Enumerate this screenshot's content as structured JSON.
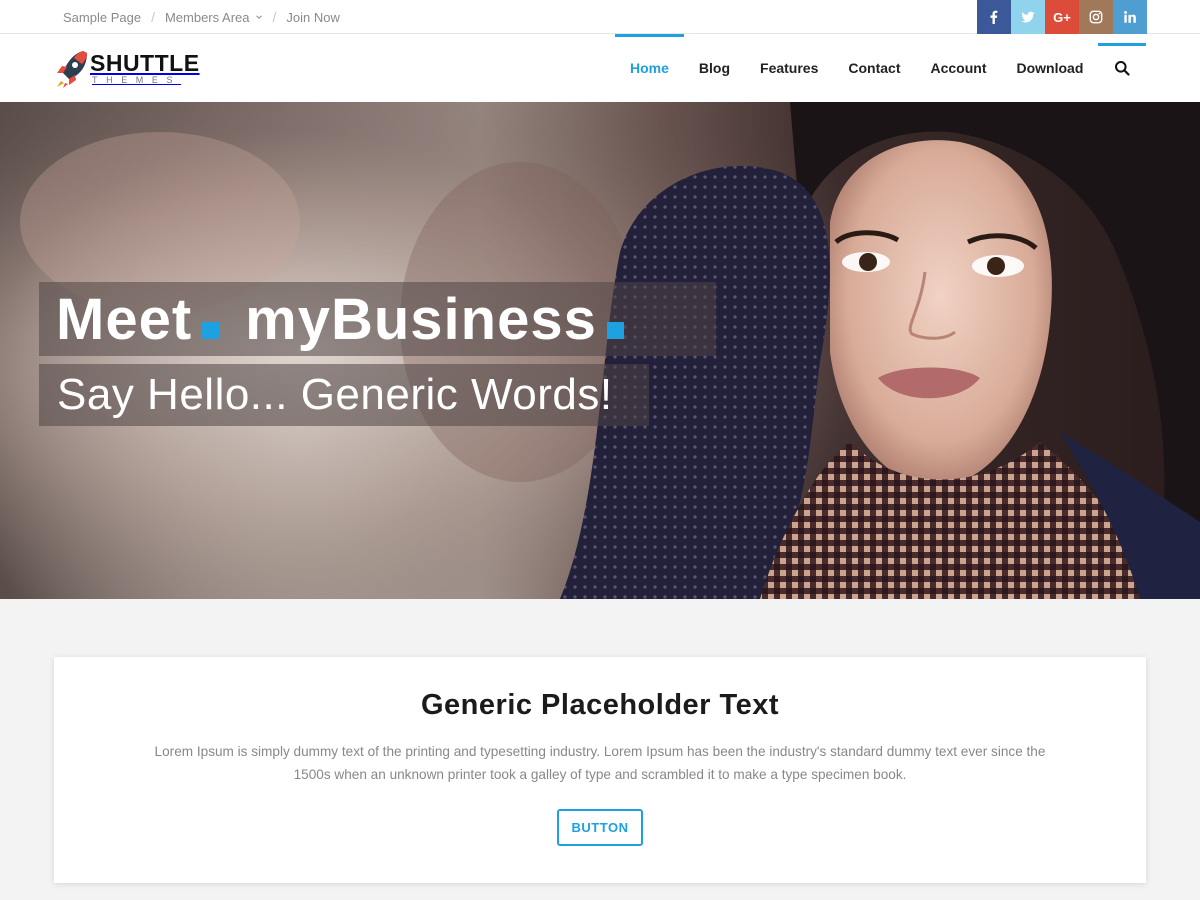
{
  "topbar": {
    "links": [
      {
        "label": "Sample Page"
      },
      {
        "label": "Members Area"
      },
      {
        "label": "Join Now"
      }
    ],
    "social": [
      {
        "name": "facebook-icon",
        "color": "#3b5998"
      },
      {
        "name": "twitter-icon",
        "color": "#8fd3ec"
      },
      {
        "name": "google-plus-icon",
        "color": "#dd4b39",
        "text": "G+"
      },
      {
        "name": "instagram-icon",
        "color": "#a0785a"
      },
      {
        "name": "linkedin-icon",
        "color": "#4f9ed2"
      }
    ]
  },
  "header": {
    "logo": {
      "brand": "SHUTTLE",
      "sub": "THEMES"
    },
    "nav": [
      {
        "label": "Home",
        "active": true
      },
      {
        "label": "Blog"
      },
      {
        "label": "Features"
      },
      {
        "label": "Contact"
      },
      {
        "label": "Account"
      },
      {
        "label": "Download"
      }
    ],
    "search_icon": "search-icon"
  },
  "hero": {
    "headline_part1": "Meet",
    "headline_part2": "myBusiness",
    "subheadline": "Say Hello... Generic Words!",
    "accent_color": "#1ea1e0"
  },
  "content": {
    "title": "Generic Placeholder Text",
    "body": "Lorem Ipsum is simply dummy text of the printing and typesetting industry. Lorem Ipsum has been the industry's standard dummy text ever since the 1500s when an unknown printer took a galley of type and scrambled it to make a type specimen book.",
    "button_label": "BUTTON"
  }
}
